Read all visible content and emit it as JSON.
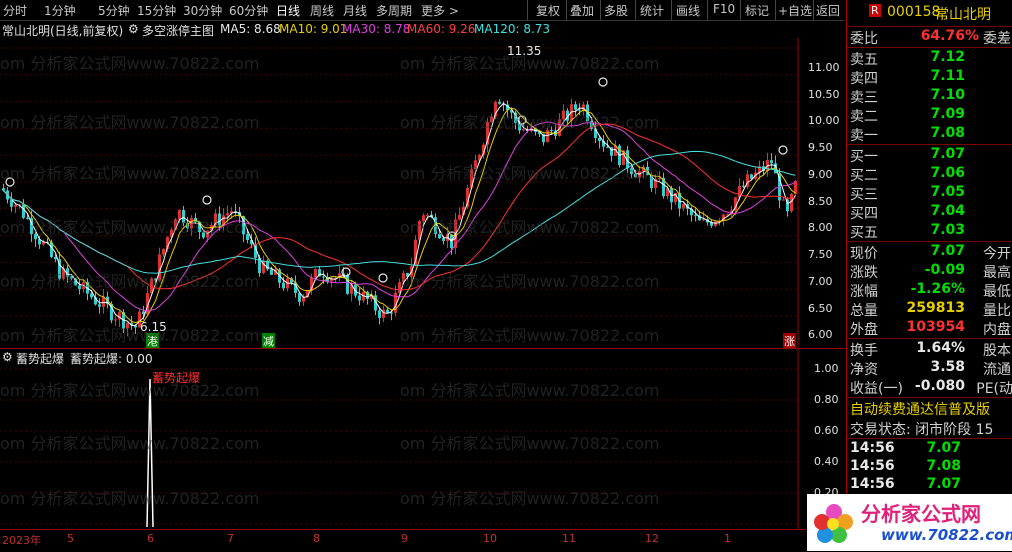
{
  "toolbar": {
    "periods": [
      "分时",
      "1分钟",
      "5分钟",
      "15分钟",
      "30分钟",
      "60分钟",
      "日线",
      "周线",
      "月线",
      "多周期",
      "更多 >"
    ],
    "active_period": "日线",
    "actions": [
      "复权",
      "叠加",
      "多股",
      "统计",
      "画线",
      "F10",
      "标记",
      "+自选",
      "返回"
    ]
  },
  "main_legend": {
    "title": "常山北明(日线,前复权)",
    "indicator": "多空涨停主图",
    "ma5": "MA5: 8.68",
    "ma10": "MA10: 9.01",
    "ma30": "MA30: 8.78",
    "ma60": "MA60: 9.26",
    "ma120": "MA120: 8.73"
  },
  "sub_legend": {
    "indicator": "蓄势起爆",
    "value": "蓄势起爆: 0.00",
    "signal": "蓄势起爆"
  },
  "y_axis_main": [
    "11.00",
    "10.50",
    "10.00",
    "9.50",
    "9.00",
    "8.50",
    "8.00",
    "7.50",
    "7.00",
    "6.50",
    "6.00"
  ],
  "y_axis_sub": [
    "1.00",
    "0.80",
    "0.60",
    "0.40",
    "0.20"
  ],
  "x_axis": [
    "2023年",
    "5",
    "6",
    "7",
    "8",
    "9",
    "10",
    "11",
    "12",
    "1"
  ],
  "annotations": {
    "high": "11.35",
    "low": "6.15",
    "tag1": "港",
    "tag2": "减",
    "tag3": "涨"
  },
  "watermark": "om 分析家公式网www.70822.com",
  "right_panel": {
    "header": {
      "badge": "R",
      "code": "000158",
      "name": "常山北明"
    },
    "ratio": {
      "label": "委比",
      "value": "64.76%",
      "label2": "委差"
    },
    "asks": [
      {
        "label": "卖五",
        "price": "7.12"
      },
      {
        "label": "卖四",
        "price": "7.11"
      },
      {
        "label": "卖三",
        "price": "7.10"
      },
      {
        "label": "卖二",
        "price": "7.09"
      },
      {
        "label": "卖一",
        "price": "7.08"
      }
    ],
    "bids": [
      {
        "label": "买一",
        "price": "7.07"
      },
      {
        "label": "买二",
        "price": "7.06"
      },
      {
        "label": "买三",
        "price": "7.05"
      },
      {
        "label": "买四",
        "price": "7.04"
      },
      {
        "label": "买五",
        "price": "7.03"
      }
    ],
    "stats": [
      {
        "label": "现价",
        "value": "7.07",
        "label2": "今开",
        "color": "green"
      },
      {
        "label": "涨跌",
        "value": "-0.09",
        "label2": "最高",
        "color": "green"
      },
      {
        "label": "涨幅",
        "value": "-1.26%",
        "label2": "最低",
        "color": "green"
      },
      {
        "label": "总量",
        "value": "259813",
        "label2": "量比",
        "color": "yellow"
      },
      {
        "label": "外盘",
        "value": "103954",
        "label2": "内盘",
        "color": "red"
      }
    ],
    "stats2": [
      {
        "label": "换手",
        "value": "1.64%",
        "label2": "股本"
      },
      {
        "label": "净资",
        "value": "3.58",
        "label2": "流通"
      },
      {
        "label": "收益(一)",
        "value": "-0.080",
        "label2": "PE(动"
      }
    ],
    "promo": "自动续费通达信普及版",
    "trade_status": "交易状态: 闭市阶段 15",
    "ticks": [
      {
        "time": "14:56",
        "price": "7.07"
      },
      {
        "time": "14:56",
        "price": "7.08"
      },
      {
        "time": "14:56",
        "price": "7.07"
      }
    ],
    "logo_text": "分析家公式网",
    "logo_url": "www.70822.com"
  }
}
